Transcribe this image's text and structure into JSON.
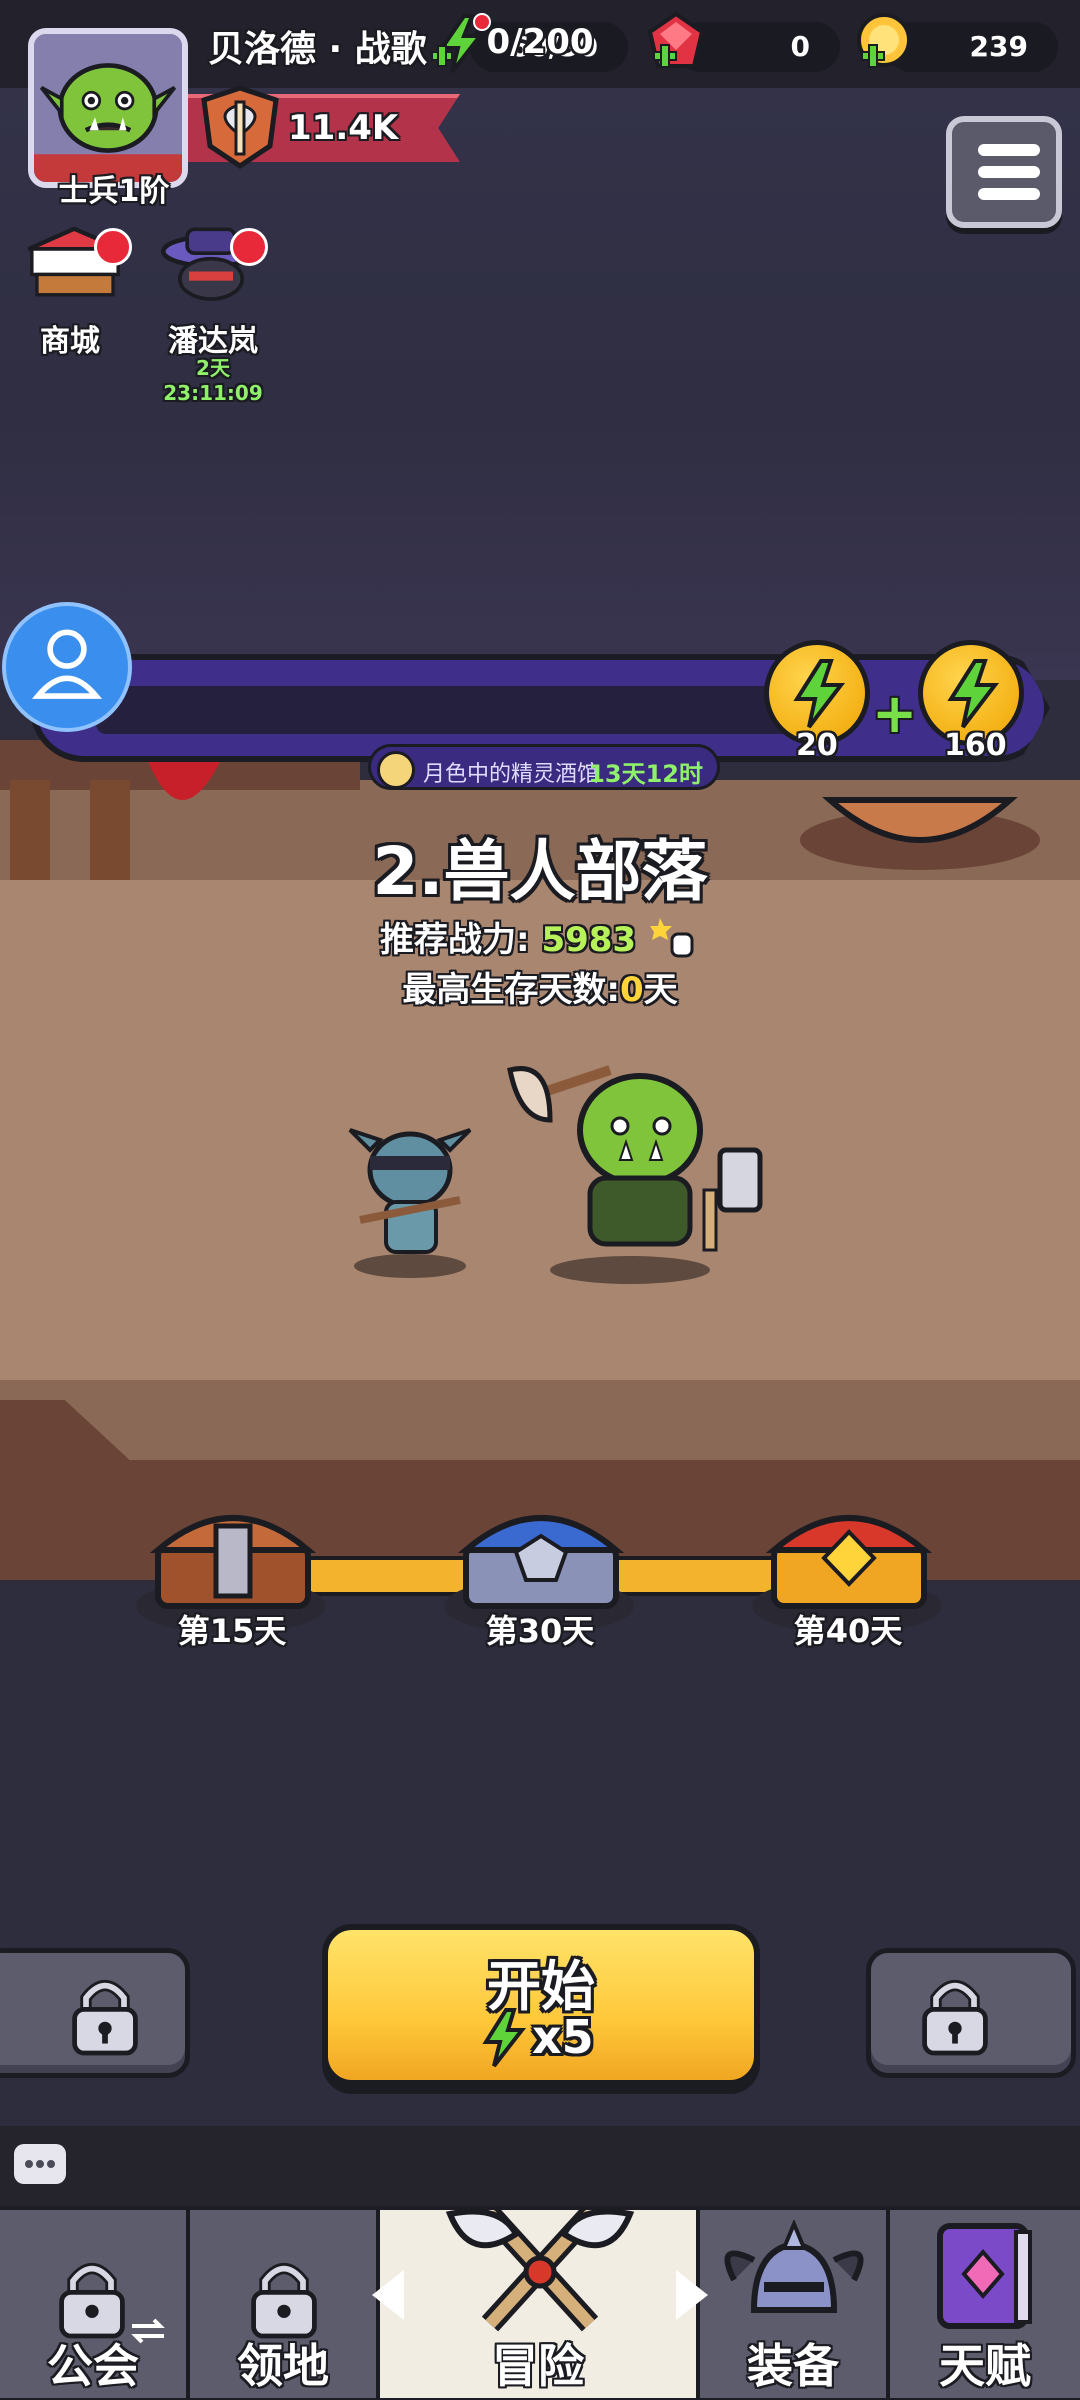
{
  "player": {
    "name": "贝洛德 · 战歌",
    "rank": "士兵1阶",
    "power": "11.4K"
  },
  "resources": {
    "energy": "60/30",
    "gems": "0",
    "gold": "239"
  },
  "side_menu": [
    {
      "label": "商城"
    },
    {
      "label": "潘达岚",
      "timer": "2天23:11:09"
    }
  ],
  "season": {
    "progress_text": "0/200",
    "progress_fraction": 0.0,
    "reward_a": "20",
    "reward_b": "160",
    "event_name": "月色中的精灵酒馆",
    "event_time": "13天12时"
  },
  "stage": {
    "title": "2.兽人部落",
    "rec_power_label": "推荐战力:",
    "rec_power_value": "5983",
    "max_days_label": "最高生存天数:",
    "max_days_value": "0",
    "max_days_unit": "天"
  },
  "chests": [
    {
      "label": "第15天",
      "kind": "wooden"
    },
    {
      "label": "第30天",
      "kind": "silver"
    },
    {
      "label": "第40天",
      "kind": "gold"
    }
  ],
  "start_button": {
    "label": "开始",
    "cost": "x5"
  },
  "nav": {
    "guild": "公会",
    "territory": "领地",
    "adventure": "冒险",
    "equipment": "装备",
    "talent": "天赋"
  },
  "colors": {
    "accent_yellow": "#ffc83a",
    "energy_green": "#79e04a",
    "season_purple": "#3f2f8a",
    "badge_red": "#e8293a"
  }
}
